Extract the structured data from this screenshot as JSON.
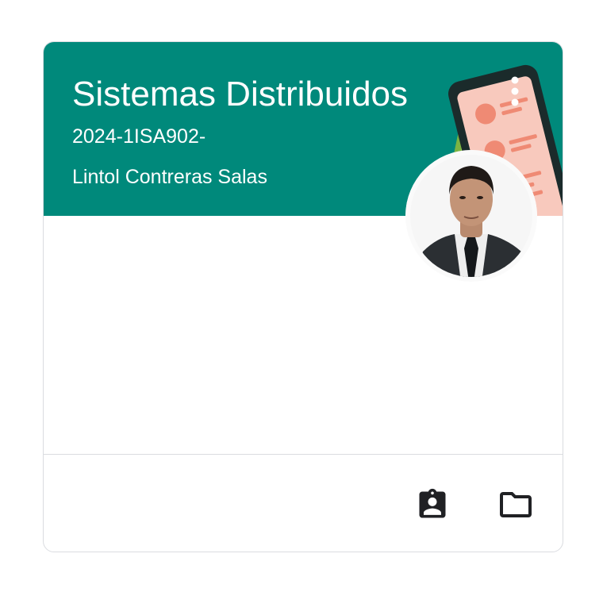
{
  "course": {
    "title": "Sistemas Distribuidos",
    "section": "2024-1ISA902-",
    "teacher": "Lintol Contreras Salas"
  },
  "colors": {
    "banner": "#00897b",
    "text_on_banner": "#ffffff",
    "icon": "#202124",
    "divider": "#dadce0"
  },
  "icons": {
    "menu": "more-vert-icon",
    "work": "assignment-ind-icon",
    "folder": "folder-icon",
    "avatar": "teacher-avatar"
  }
}
